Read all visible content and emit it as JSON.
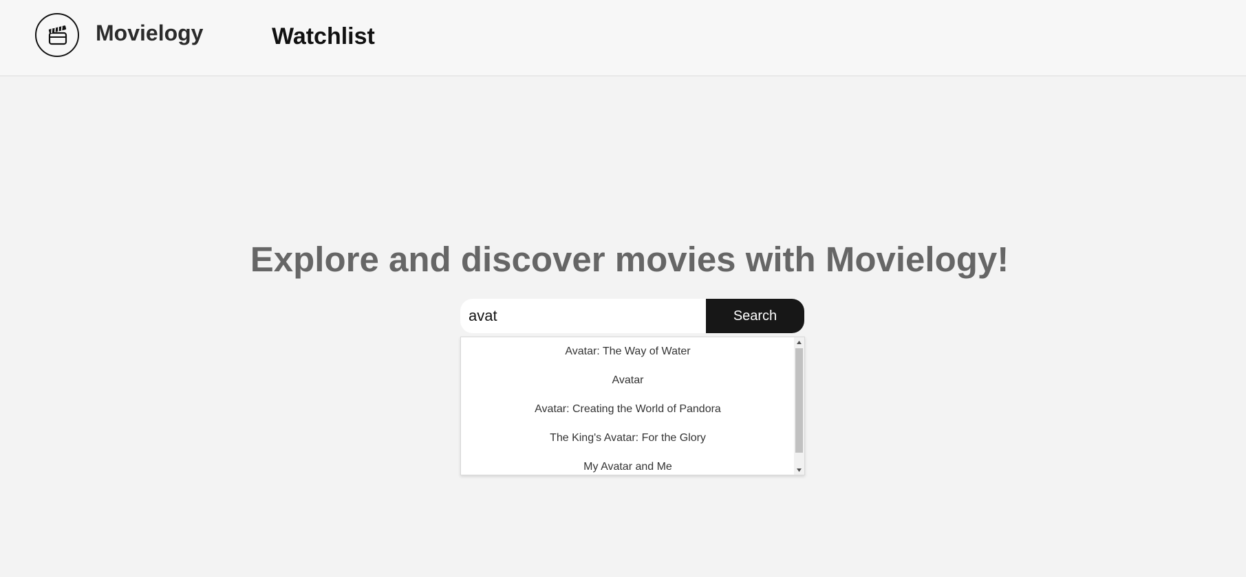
{
  "header": {
    "brand": "Movielogy",
    "logo_icon": "clapperboard-icon",
    "nav": {
      "watchlist_label": "Watchlist"
    }
  },
  "hero": {
    "title": "Explore and discover movies with Movielogy!"
  },
  "search": {
    "value": "avat",
    "button_label": "Search",
    "suggestions": [
      "Avatar: The Way of Water",
      "Avatar",
      "Avatar: Creating the World of Pandora",
      "The King's Avatar: For the Glory",
      "My Avatar and Me"
    ]
  },
  "colors": {
    "page_background": "#f3f3f3",
    "header_background": "#f7f7f7",
    "button_background": "#171717",
    "title_color": "#666666"
  }
}
